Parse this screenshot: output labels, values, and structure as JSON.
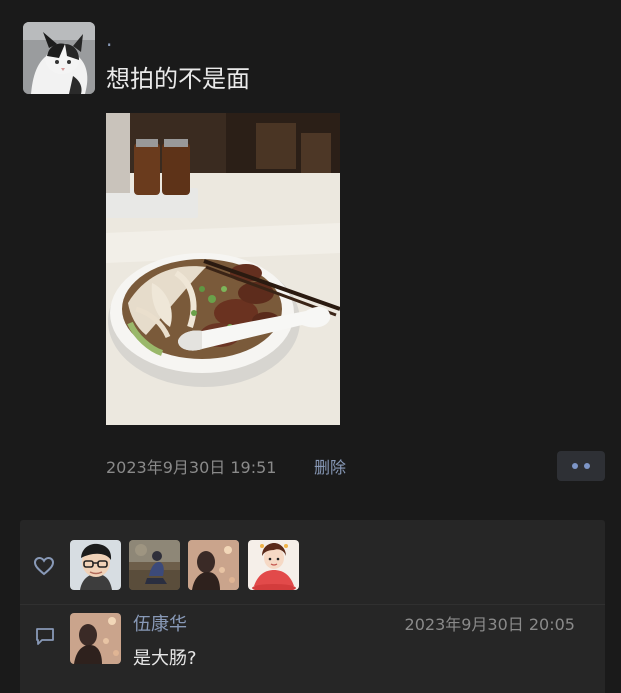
{
  "post": {
    "author_name": ".",
    "text": "想拍的不是面",
    "timestamp": "2023年9月30日 19:51",
    "delete_label": "删除",
    "more_icon": "more-dots-icon",
    "photo_subject": "noodle-bowl"
  },
  "likes": {
    "icon": "heart-icon",
    "avatars": [
      "avatar-boy-glasses",
      "avatar-figure-sitting",
      "avatar-shadow-portrait",
      "avatar-cartoon-girl"
    ]
  },
  "comments": [
    {
      "icon": "comment-icon",
      "name": "伍康华",
      "time": "2023年9月30日 20:05",
      "text": "是大肠?"
    }
  ],
  "colors": {
    "background": "#1a1a1a",
    "panel": "#262626",
    "name_link": "#8899b7",
    "muted": "#8a8a8a",
    "more_dots": "#7d95c7"
  }
}
